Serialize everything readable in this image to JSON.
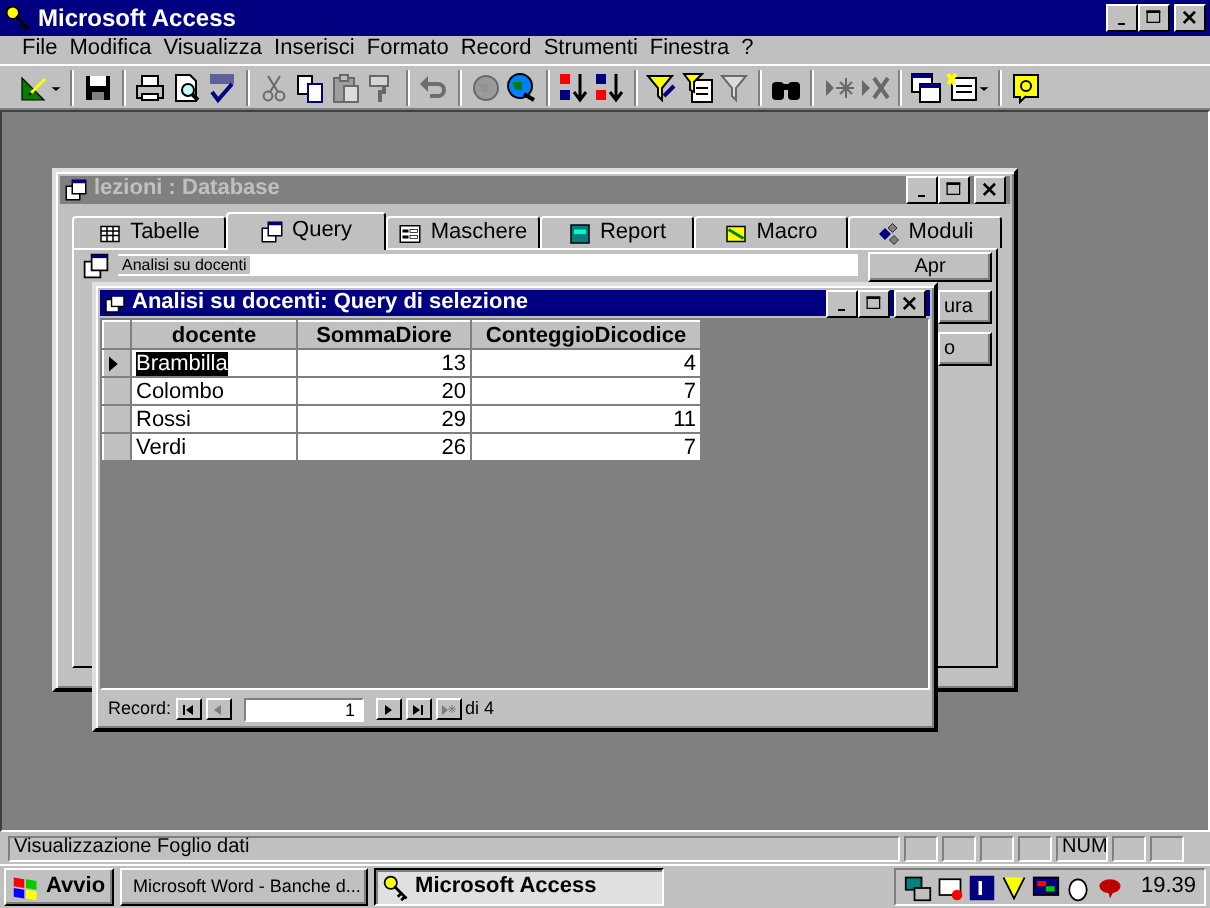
{
  "app": {
    "title": "Microsoft Access"
  },
  "menu": [
    "File",
    "Modifica",
    "Visualizza",
    "Inserisci",
    "Formato",
    "Record",
    "Strumenti",
    "Finestra",
    "?"
  ],
  "toolbar": [
    {
      "kind": "design",
      "disabled": false,
      "dropdown": true
    },
    {
      "kind": "separator"
    },
    {
      "kind": "save",
      "disabled": false
    },
    {
      "kind": "separator"
    },
    {
      "kind": "print",
      "disabled": false
    },
    {
      "kind": "preview",
      "disabled": false
    },
    {
      "kind": "spelling",
      "disabled": false
    },
    {
      "kind": "separator"
    },
    {
      "kind": "cut",
      "disabled": true
    },
    {
      "kind": "copy",
      "disabled": false
    },
    {
      "kind": "paste",
      "disabled": true
    },
    {
      "kind": "painter",
      "disabled": true
    },
    {
      "kind": "separator"
    },
    {
      "kind": "undo",
      "disabled": true
    },
    {
      "kind": "separator"
    },
    {
      "kind": "web",
      "disabled": true
    },
    {
      "kind": "hyperlink",
      "disabled": false
    },
    {
      "kind": "separator"
    },
    {
      "kind": "sort-asc",
      "disabled": false
    },
    {
      "kind": "sort-desc",
      "disabled": false
    },
    {
      "kind": "separator"
    },
    {
      "kind": "filter-selection",
      "disabled": false
    },
    {
      "kind": "filter-form",
      "disabled": false
    },
    {
      "kind": "apply-filter",
      "disabled": true
    },
    {
      "kind": "separator"
    },
    {
      "kind": "find",
      "disabled": false
    },
    {
      "kind": "separator"
    },
    {
      "kind": "new-record",
      "disabled": true
    },
    {
      "kind": "delete-record",
      "disabled": true
    },
    {
      "kind": "separator"
    },
    {
      "kind": "database-window",
      "disabled": false
    },
    {
      "kind": "new-object",
      "disabled": false,
      "dropdown": true
    },
    {
      "kind": "separator"
    },
    {
      "kind": "help",
      "disabled": false
    }
  ],
  "database_window": {
    "title": "lezioni : Database",
    "active": false,
    "tabs": [
      {
        "label": "Tabelle",
        "kind": "tables",
        "selected": false
      },
      {
        "label": "Query",
        "kind": "queries",
        "selected": true
      },
      {
        "label": "Maschere",
        "kind": "forms",
        "selected": false
      },
      {
        "label": "Report",
        "kind": "reports",
        "selected": false
      },
      {
        "label": "Macro",
        "kind": "macros",
        "selected": false
      },
      {
        "label": "Moduli",
        "kind": "modules",
        "selected": false
      }
    ],
    "objects": [
      {
        "label": "Analisi su docenti",
        "selected": true
      }
    ],
    "buttons": [
      "Apr",
      "ura",
      "o"
    ]
  },
  "query_window": {
    "title": "Analisi su docenti: Query di selezione",
    "active": true,
    "columns": [
      "docente",
      "SommaDiore",
      "ConteggioDicodice"
    ],
    "rows": [
      {
        "cells": [
          "Brambilla",
          "13",
          "4"
        ],
        "selected": true
      },
      {
        "cells": [
          "Colombo",
          "20",
          "7"
        ],
        "selected": false
      },
      {
        "cells": [
          "Rossi",
          "29",
          "11"
        ],
        "selected": false
      },
      {
        "cells": [
          "Verdi",
          "26",
          "7"
        ],
        "selected": false
      }
    ],
    "navigation": {
      "label": "Record:",
      "value": "1",
      "total": "di 4",
      "buttons": [
        {
          "kind": "first",
          "disabled": false
        },
        {
          "kind": "previous",
          "disabled": true
        },
        {
          "kind": "next",
          "disabled": false
        },
        {
          "kind": "last",
          "disabled": false
        },
        {
          "kind": "new",
          "disabled": true
        }
      ]
    }
  },
  "status_bar": {
    "text": "Visualizzazione Foglio dati",
    "indicators": [
      {
        "on": false
      },
      {
        "on": false
      },
      {
        "on": false
      },
      {
        "on": false
      },
      {
        "label": "NUM",
        "on": true
      },
      {
        "on": false
      },
      {
        "on": false
      }
    ]
  },
  "taskbar": {
    "start": "Avvio",
    "tasks": [
      {
        "label": "Microsoft Word - Banche d...",
        "kind": "word",
        "selected": false
      },
      {
        "label": "Microsoft Access",
        "kind": "access",
        "selected": true
      }
    ],
    "clock": "19.39"
  }
}
